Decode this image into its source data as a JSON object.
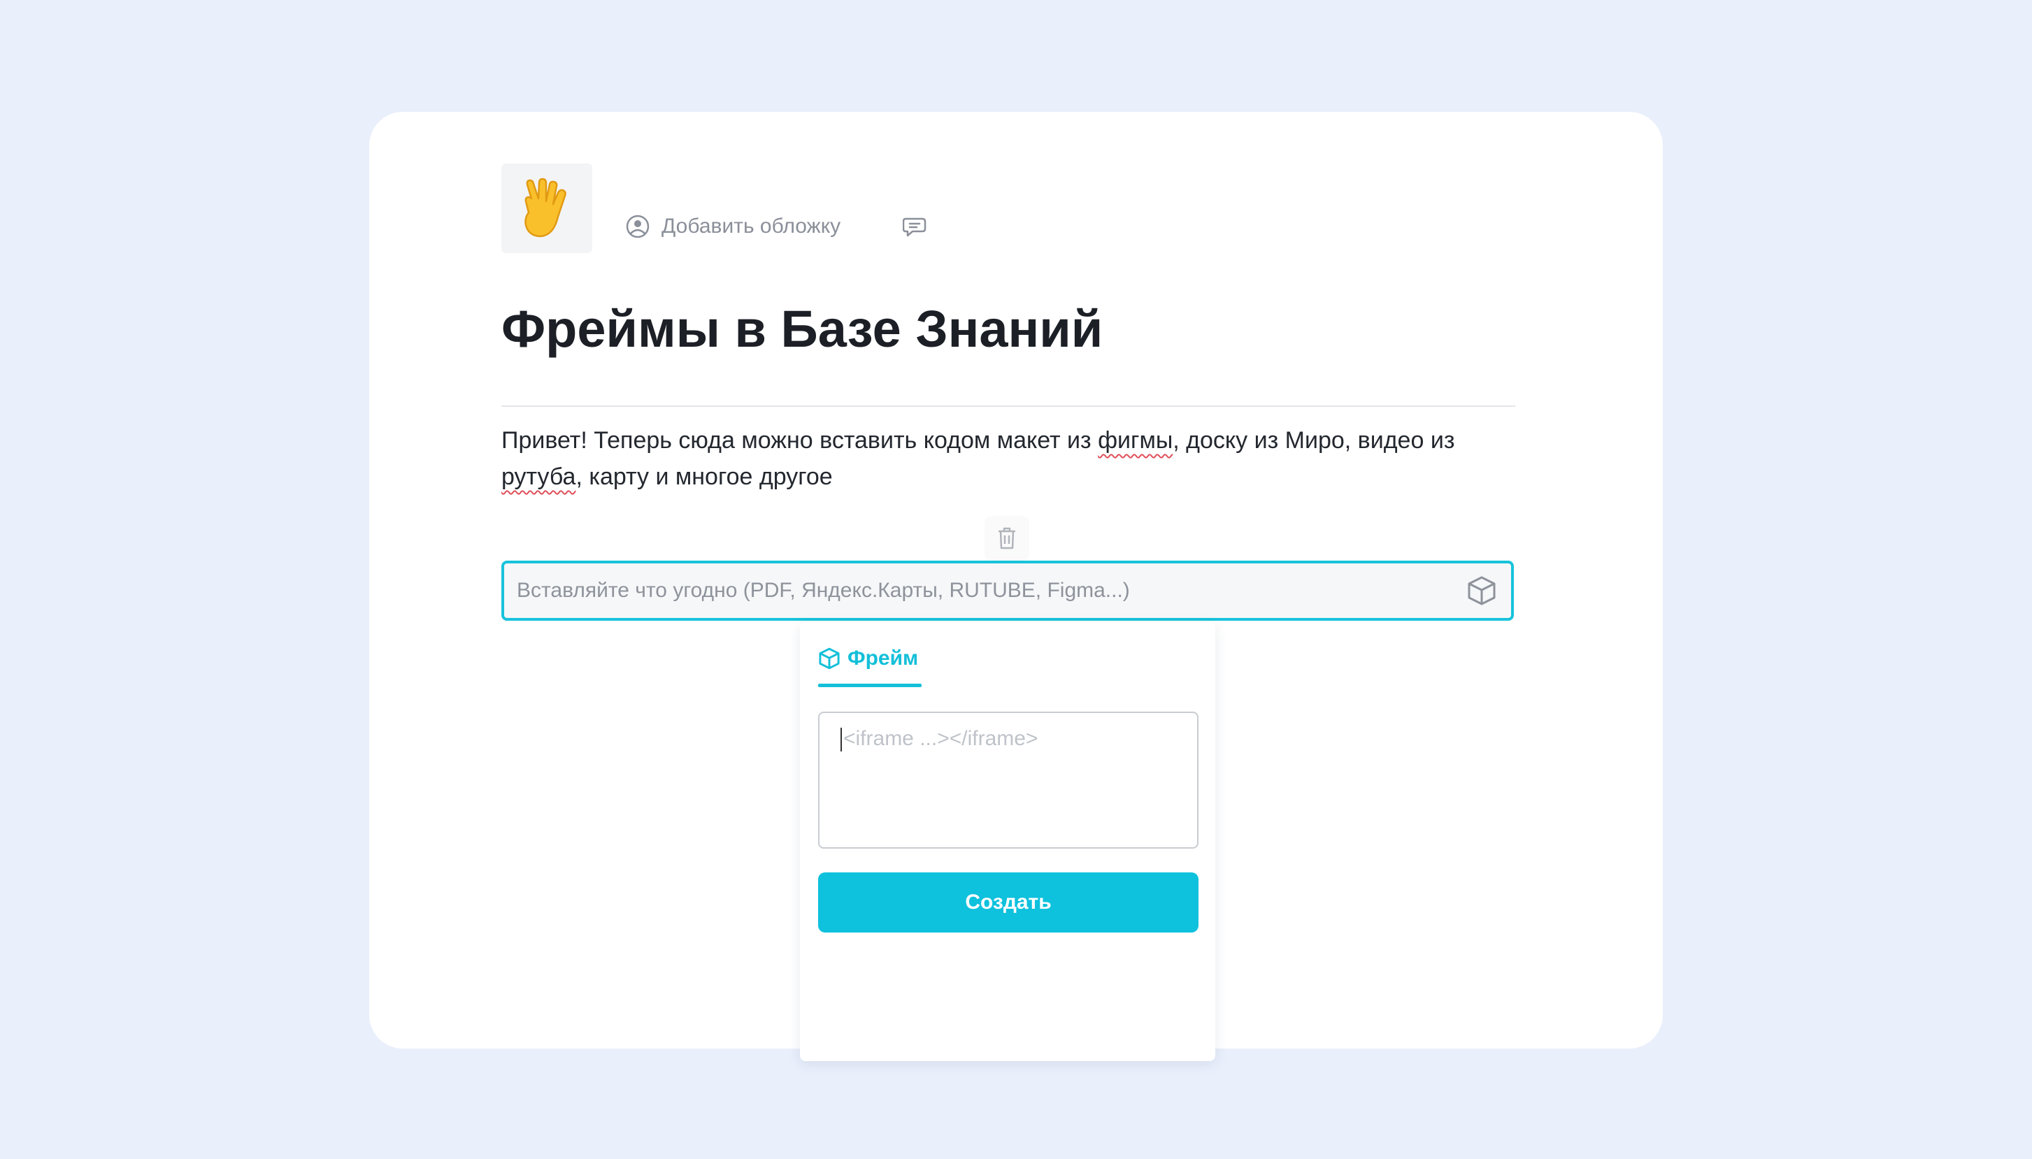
{
  "page": {
    "cover_button_label": "Добавить обложку",
    "title": "Фреймы в Базе Знаний",
    "paragraph": {
      "part1": "Привет! Теперь сюда можно вставить кодом макет из ",
      "spell1": "фигмы",
      "part2": ", доску из Миро, видео из ",
      "spell2": "рутуба",
      "part3": ", карту и многое другое"
    }
  },
  "embed_input": {
    "placeholder": "Вставляйте что угодно (PDF, Яндекс.Карты, RUTUBE, Figma...)"
  },
  "popup": {
    "tab_label": "Фрейм",
    "code_placeholder": "<iframe ...></iframe>",
    "create_button_label": "Создать"
  },
  "icons": {
    "emoji": "vulcan-salute-hand",
    "cover": "cover-circle-icon",
    "comment": "comment-icon",
    "trash": "trash-icon",
    "embed": "cube-icon"
  },
  "colors": {
    "accent": "#13bfd9",
    "button": "#0ec1dd",
    "background": "#e9effb",
    "card": "#ffffff"
  }
}
